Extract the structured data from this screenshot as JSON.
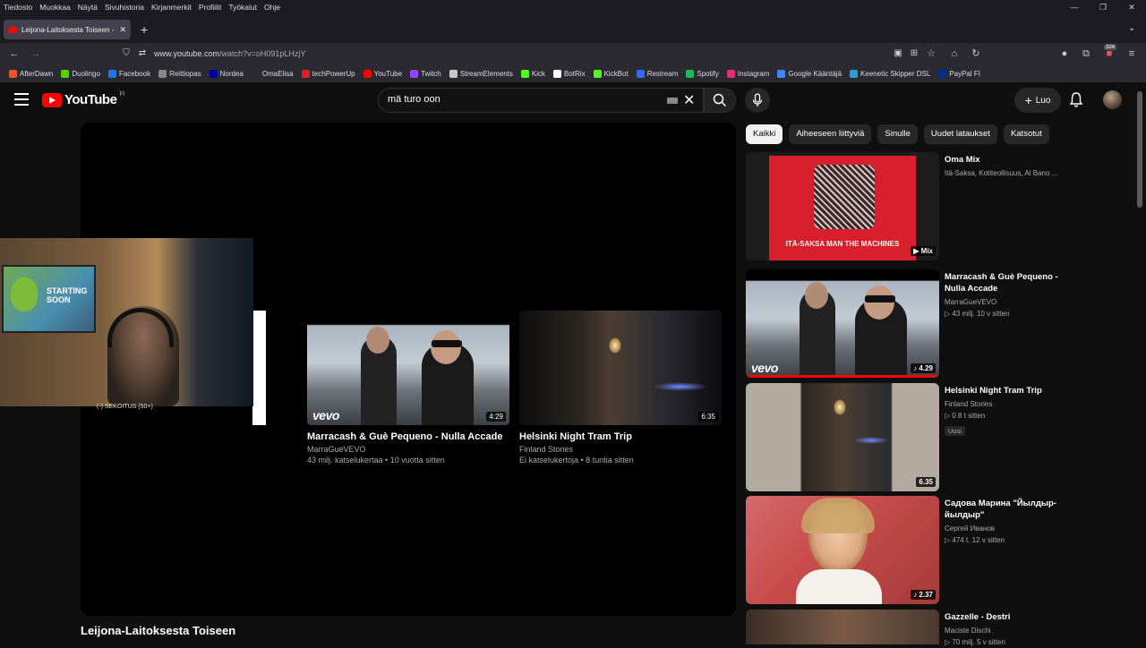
{
  "menubar": {
    "items": [
      "Tiedosto",
      "Muokkaa",
      "Näytä",
      "Sivuhistoria",
      "Kirjanmerkit",
      "Profiilit",
      "Työkalut",
      "Ohje"
    ]
  },
  "tab": {
    "title": "Leijona-Laitoksesta Toiseen - YouTube"
  },
  "address": {
    "domain": "www.youtube.com",
    "path": "/watch?v=oH091pLHzjY"
  },
  "extensions": {
    "badge": "324"
  },
  "bookmarks": [
    {
      "label": "AfterDawn",
      "color": "#e4572e"
    },
    {
      "label": "Duolingo",
      "color": "#58cc02"
    },
    {
      "label": "Facebook",
      "color": "#1877f2"
    },
    {
      "label": "Reittiopas",
      "color": "#888888"
    },
    {
      "label": "Nordea",
      "color": "#0000a0"
    },
    {
      "label": "OmaElisa",
      "color": "#2b2a33"
    },
    {
      "label": "techPowerUp",
      "color": "#e02020"
    },
    {
      "label": "YouTube",
      "color": "#ff0000"
    },
    {
      "label": "Twitch",
      "color": "#9146ff"
    },
    {
      "label": "StreamElements",
      "color": "#c8c8c8"
    },
    {
      "label": "Kick",
      "color": "#53fc18"
    },
    {
      "label": "BotRix",
      "color": "#ffffff"
    },
    {
      "label": "KickBot",
      "color": "#53fc18"
    },
    {
      "label": "Restream",
      "color": "#2e6bff"
    },
    {
      "label": "Spotify",
      "color": "#1db954"
    },
    {
      "label": "Instagram",
      "color": "#e1306c"
    },
    {
      "label": "Google Kääntäjä",
      "color": "#4285f4"
    },
    {
      "label": "Keenetic Skipper DSL",
      "color": "#2d9cdb"
    },
    {
      "label": "PayPal FI",
      "color": "#003087"
    }
  ],
  "youtube": {
    "logo_text": "YouTube",
    "country": "FI",
    "search_value": "mä turo oon",
    "create_label": "Luo"
  },
  "player": {
    "title": "Leijona-Laitoksesta Toiseen",
    "overlay_label": "SEKOITUS (50+)",
    "endcards": [
      {
        "title": "Marracash & Guè Pequeno - Nulla Accade",
        "channel": "MarraGueVEVO",
        "meta": "43 milj. katselukertaa • 10 vuotta sitten",
        "duration": "4:29",
        "brand": "vevo"
      },
      {
        "title": "Helsinki Night Tram Trip",
        "channel": "Finland Stories",
        "meta": "Ei katselukertoja • 8 tuntia sitten",
        "duration": "6:35"
      }
    ]
  },
  "chips": [
    "Kaikki",
    "Aiheeseen liittyviä",
    "Sinulle",
    "Uudet lataukset",
    "Katsotut"
  ],
  "recommendations": [
    {
      "title": "Oma Mix",
      "sub1": "Itä-Saksa, Kotiteollisuus, Al Bano ...",
      "sub2": "",
      "badge_text": "Mix",
      "thumb_caption": "ITÄ-SAKSA   MAN THE MACHINES"
    },
    {
      "title": "Marracash & Guè Pequeno - Nulla Accade",
      "sub1": "MarraGueVEVO",
      "sub2": "▷ 43 milj.   10 v sitten",
      "badge_text": "♪ 4.29",
      "brand": "vevo",
      "watched_fraction": 1.0
    },
    {
      "title": "Helsinki Night Tram Trip",
      "sub1": "Finland Stories",
      "sub2": "▷ 0   8 t sitten",
      "new_label": "Uusi",
      "badge_text": "6.35"
    },
    {
      "title": "Садова Марина \"Йылдыр-йылдыр\"",
      "sub1": "Сергей Иванов",
      "sub2": "▷ 474 t.   12 v sitten",
      "badge_text": "♪ 2.37"
    },
    {
      "title": "Gazzelle - Destri",
      "sub1": "Maciste Dischi",
      "sub2": "▷ 70 milj.   5 v sitten"
    }
  ]
}
